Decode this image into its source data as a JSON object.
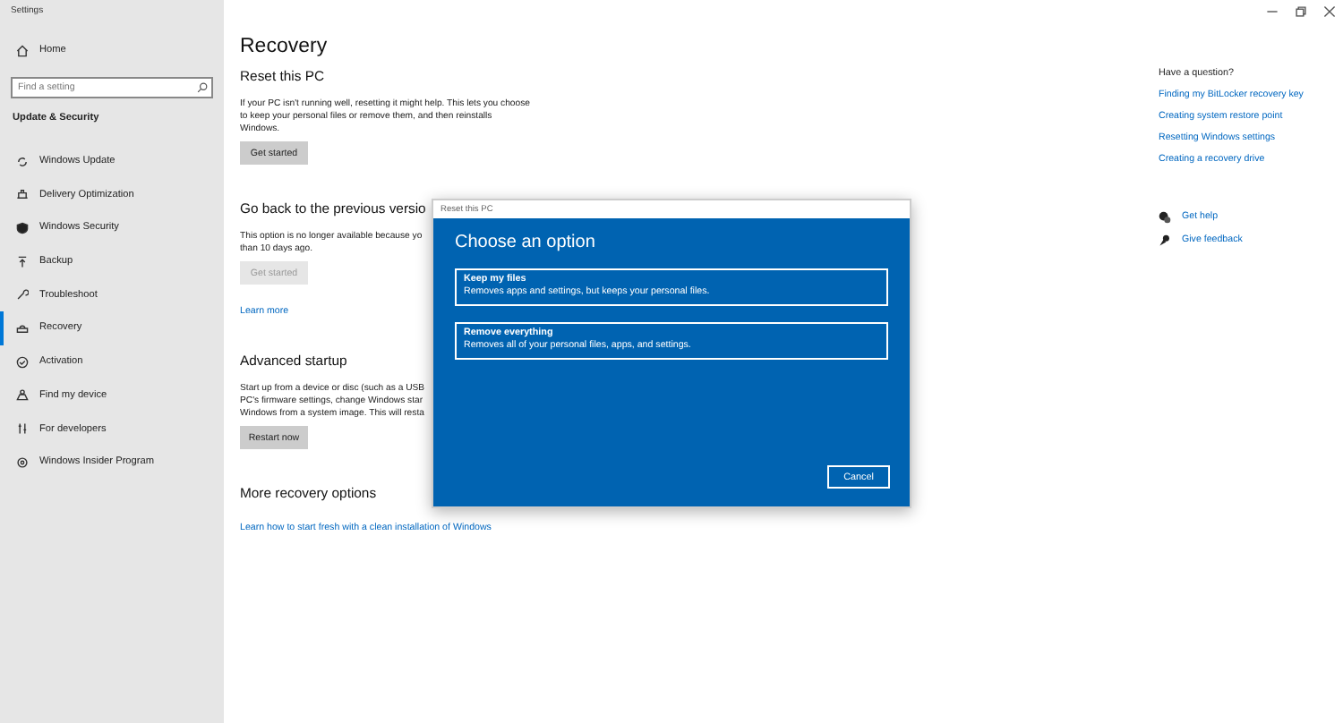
{
  "window": {
    "title": "Settings"
  },
  "sidebar": {
    "home": "Home",
    "search": {
      "placeholder": "Find a setting"
    },
    "section": "Update & Security",
    "items": [
      {
        "label": "Windows Update",
        "selected": false
      },
      {
        "label": "Delivery Optimization",
        "selected": false
      },
      {
        "label": "Windows Security",
        "selected": false
      },
      {
        "label": "Backup",
        "selected": false
      },
      {
        "label": "Troubleshoot",
        "selected": false
      },
      {
        "label": "Recovery",
        "selected": true
      },
      {
        "label": "Activation",
        "selected": false
      },
      {
        "label": "Find my device",
        "selected": false
      },
      {
        "label": "For developers",
        "selected": false
      },
      {
        "label": "Windows Insider Program",
        "selected": false
      }
    ]
  },
  "page": {
    "title": "Recovery",
    "sections": [
      {
        "heading": "Reset this PC",
        "lines": [
          "If your PC isn't running well, resetting it might help. This lets you choose",
          "to keep your personal files or remove them, and then reinstalls",
          "Windows."
        ],
        "button": {
          "label": "Get started",
          "disabled": false
        }
      },
      {
        "heading": "Go back to the previous versio",
        "lines": [
          "This option is no longer available because yo",
          "than 10 days ago."
        ],
        "button": {
          "label": "Get started",
          "disabled": true
        },
        "link": "Learn more"
      },
      {
        "heading": "Advanced startup",
        "lines": [
          "Start up from a device or disc (such as a USB",
          "PC's firmware settings, change Windows star",
          "Windows from a system image. This will resta"
        ],
        "button": {
          "label": "Restart now",
          "disabled": false
        }
      },
      {
        "heading": "More recovery options",
        "link": "Learn how to start fresh with a clean installation of Windows"
      }
    ]
  },
  "help": {
    "heading": "Have a question?",
    "links": [
      "Finding my BitLocker recovery key",
      "Creating system restore point",
      "Resetting Windows settings",
      "Creating a recovery drive"
    ],
    "actions": [
      "Get help",
      "Give feedback"
    ]
  },
  "dialog": {
    "title": "Reset this PC",
    "heading": "Choose an option",
    "options": [
      {
        "title": "Keep my files",
        "description": "Removes apps and settings, but keeps your personal files."
      },
      {
        "title": "Remove everything",
        "description": "Removes all of your personal files, apps, and settings."
      }
    ],
    "cancel": "Cancel"
  }
}
